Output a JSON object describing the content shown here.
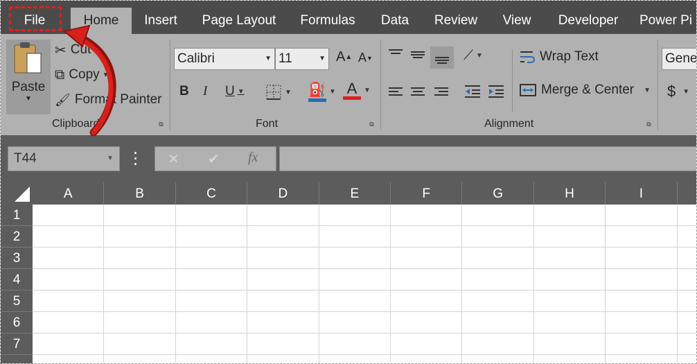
{
  "tabs": [
    {
      "label": "File"
    },
    {
      "label": "Home"
    },
    {
      "label": "Insert"
    },
    {
      "label": "Page Layout"
    },
    {
      "label": "Formulas"
    },
    {
      "label": "Data"
    },
    {
      "label": "Review"
    },
    {
      "label": "View"
    },
    {
      "label": "Developer"
    },
    {
      "label": "Power Pi"
    }
  ],
  "clipboard": {
    "paste_label": "Paste",
    "cut_label": "Cut",
    "copy_label": "Copy",
    "format_painter_label": "Format Painter",
    "group_label": "Clipboard"
  },
  "font": {
    "font_name": "Calibri",
    "font_size": "11",
    "bold": "B",
    "italic": "I",
    "underline": "U",
    "grow": "A",
    "shrink": "A",
    "font_color_glyph": "A",
    "group_label": "Font"
  },
  "alignment": {
    "wrap_text_label": "Wrap Text",
    "merge_center_label": "Merge & Center",
    "group_label": "Alignment"
  },
  "number": {
    "format_value": "Gener",
    "currency_symbol": "$"
  },
  "formula_bar": {
    "name_box_value": "T44",
    "cancel_glyph": "✕",
    "enter_glyph": "✔",
    "fx_glyph": "fx",
    "formula_value": ""
  },
  "grid": {
    "columns": [
      "A",
      "B",
      "C",
      "D",
      "E",
      "F",
      "G",
      "H",
      "I"
    ],
    "rows": [
      "1",
      "2",
      "3",
      "4",
      "5",
      "6",
      "7"
    ]
  },
  "colors": {
    "tab_bar": "#4b4b4b",
    "ribbon": "#b1b1b1",
    "header": "#5c5c5c",
    "annotation": "#d7211b"
  }
}
